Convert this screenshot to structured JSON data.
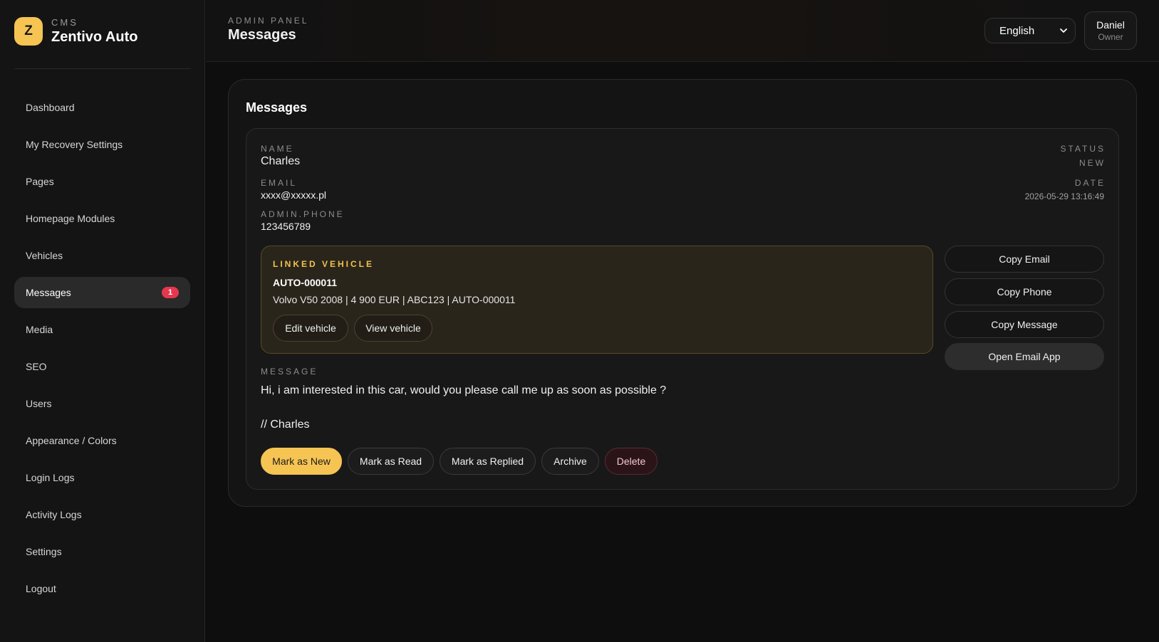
{
  "brand": {
    "logo_letter": "Z",
    "sub": "CMS",
    "name": "Zentivo Auto"
  },
  "sidebar": {
    "items": [
      {
        "label": "Dashboard"
      },
      {
        "label": "My Recovery Settings"
      },
      {
        "label": "Pages"
      },
      {
        "label": "Homepage Modules"
      },
      {
        "label": "Vehicles"
      },
      {
        "label": "Messages",
        "badge": "1",
        "active": true
      },
      {
        "label": "Media"
      },
      {
        "label": "SEO"
      },
      {
        "label": "Users"
      },
      {
        "label": "Appearance / Colors"
      },
      {
        "label": "Login Logs"
      },
      {
        "label": "Activity Logs"
      },
      {
        "label": "Settings"
      },
      {
        "label": "Logout"
      }
    ]
  },
  "header": {
    "sub": "ADMIN PANEL",
    "title": "Messages",
    "language": "English",
    "user_name": "Daniel",
    "user_role": "Owner"
  },
  "panel": {
    "title": "Messages"
  },
  "message": {
    "name_label": "NAME",
    "name": "Charles",
    "email_label": "EMAIL",
    "email": "xxxx@xxxxx.pl",
    "phone_label": "ADMIN.PHONE",
    "phone": "123456789",
    "status_label": "STATUS",
    "status": "NEW",
    "date_label": "DATE",
    "date": "2026-05-29 13:16:49",
    "vehicle": {
      "label": "LINKED VEHICLE",
      "id": "AUTO-000011",
      "desc": "Volvo V50 2008 | 4 900 EUR | ABC123 | AUTO-000011",
      "edit_label": "Edit vehicle",
      "view_label": "View vehicle"
    },
    "side_actions": {
      "copy_email": "Copy Email",
      "copy_phone": "Copy Phone",
      "copy_message": "Copy Message",
      "open_email": "Open Email App"
    },
    "message_label": "MESSAGE",
    "body_line1": "Hi, i am interested in this car, would you please call me up as soon as possible ?",
    "body_line2": "// Charles",
    "actions": {
      "mark_new": "Mark as New",
      "mark_read": "Mark as Read",
      "mark_replied": "Mark as Replied",
      "archive": "Archive",
      "delete": "Delete"
    }
  },
  "colors": {
    "accent": "#f6c453",
    "badge": "#e5384f",
    "background": "#0e0e0e",
    "vehicle_box": "#2a251b"
  }
}
